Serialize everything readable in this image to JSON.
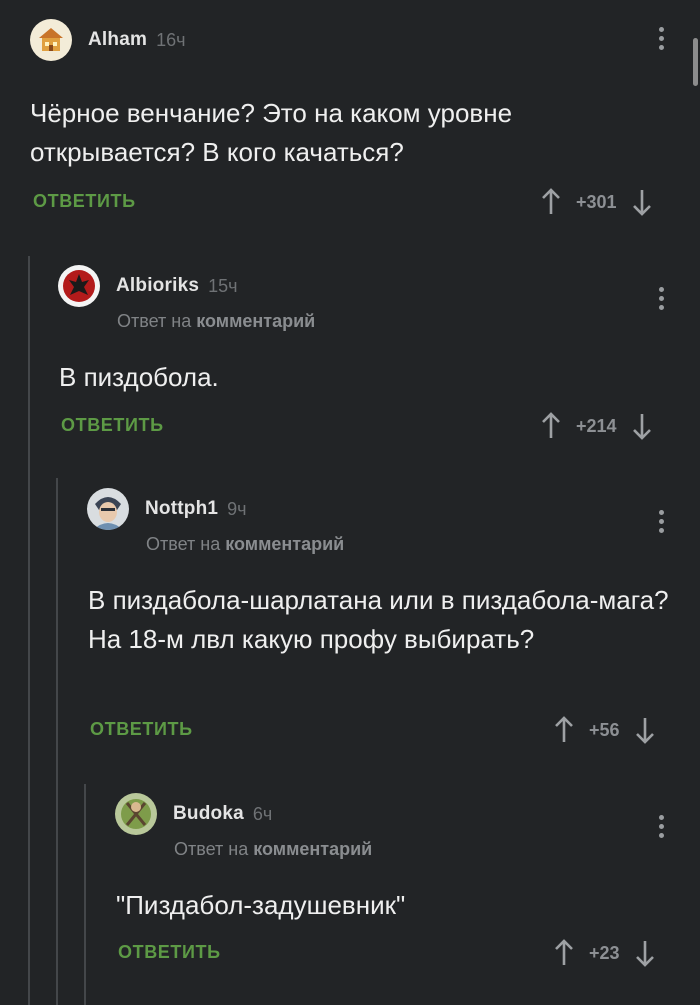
{
  "reply_action_label": "ОТВЕТИТЬ",
  "reply_to_prefix": "Ответ на",
  "reply_to_target": "комментарий",
  "accent_color": "#5d9a45",
  "comments": [
    {
      "author": "Alham",
      "time": "16ч",
      "avatar": "cartoon-house-avatar",
      "text": "Чёрное венчание? Это на каком уровне открывается? В кого качаться?",
      "score": "+301"
    },
    {
      "author": "Albioriks",
      "time": "15ч",
      "avatar": "horde-emblem-avatar",
      "text": "В пиздобола.",
      "score": "+214"
    },
    {
      "author": "Nottph1",
      "time": "9ч",
      "avatar": "anime-character-avatar",
      "text": "В пиздабола-шарлатана или в пиздабола-мага? На 18-м лвл какую профу выбирать?",
      "score": "+56"
    },
    {
      "author": "Budoka",
      "time": "6ч",
      "avatar": "green-figure-avatar",
      "text": "\"Пиздабол-задушевник\"",
      "score": "+23"
    }
  ]
}
